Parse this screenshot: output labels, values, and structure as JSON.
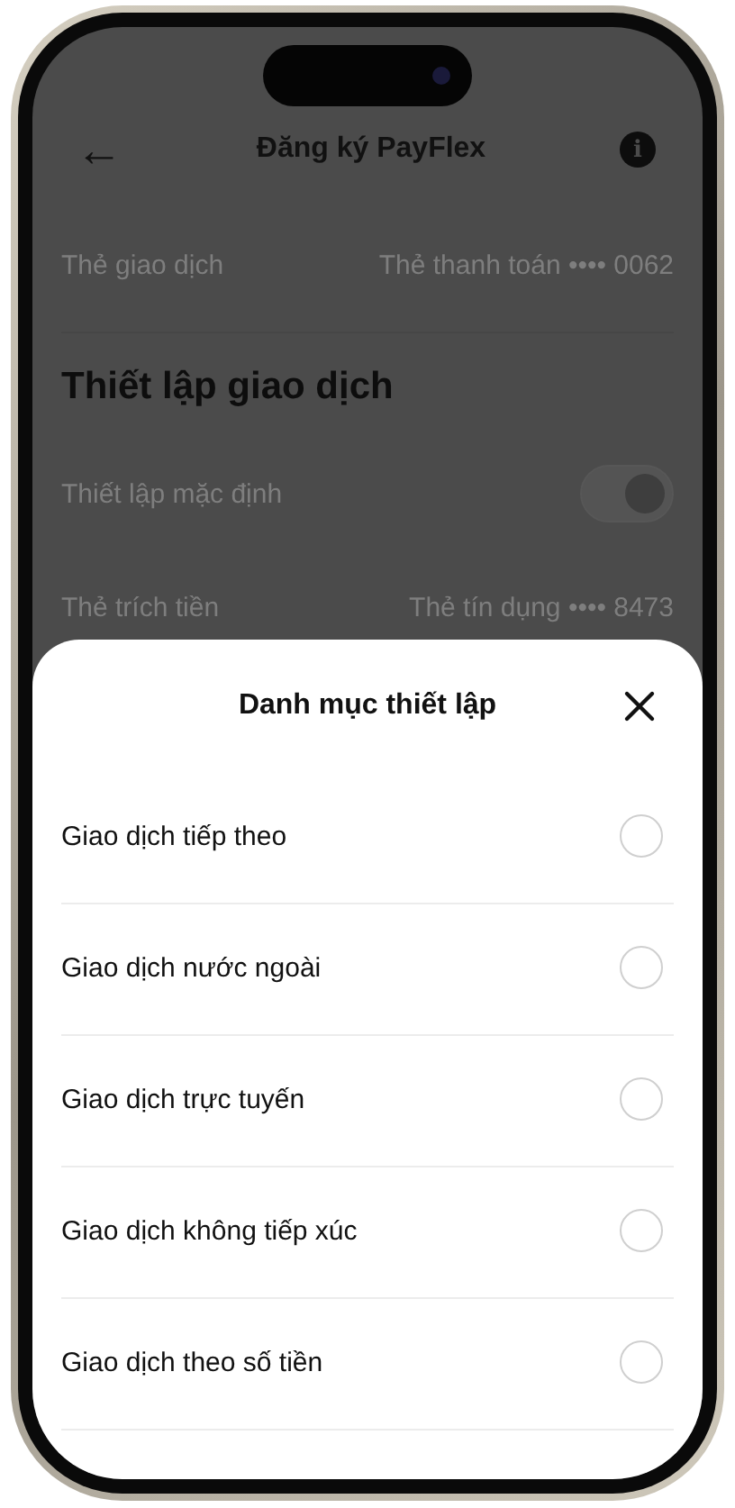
{
  "header": {
    "back": "←",
    "title": "Đăng ký PayFlex",
    "info": "i"
  },
  "card_row": {
    "label": "Thẻ giao dịch",
    "value": "Thẻ thanh toán •••• 0062"
  },
  "section_title": "Thiết lập giao dịch",
  "default_setting": {
    "label": "Thiết lập mặc định",
    "on": true
  },
  "debit_row": {
    "label": "Thẻ trích tiền",
    "value": "Thẻ tín dụng •••• 8473"
  },
  "sheet": {
    "title": "Danh mục thiết lập",
    "options": [
      {
        "label": "Giao dịch tiếp theo",
        "selected": false
      },
      {
        "label": "Giao dịch nước ngoài",
        "selected": false
      },
      {
        "label": "Giao dịch trực tuyến",
        "selected": false
      },
      {
        "label": "Giao dịch không tiếp xúc",
        "selected": false
      },
      {
        "label": "Giao dịch theo số tiền",
        "selected": false
      }
    ]
  }
}
